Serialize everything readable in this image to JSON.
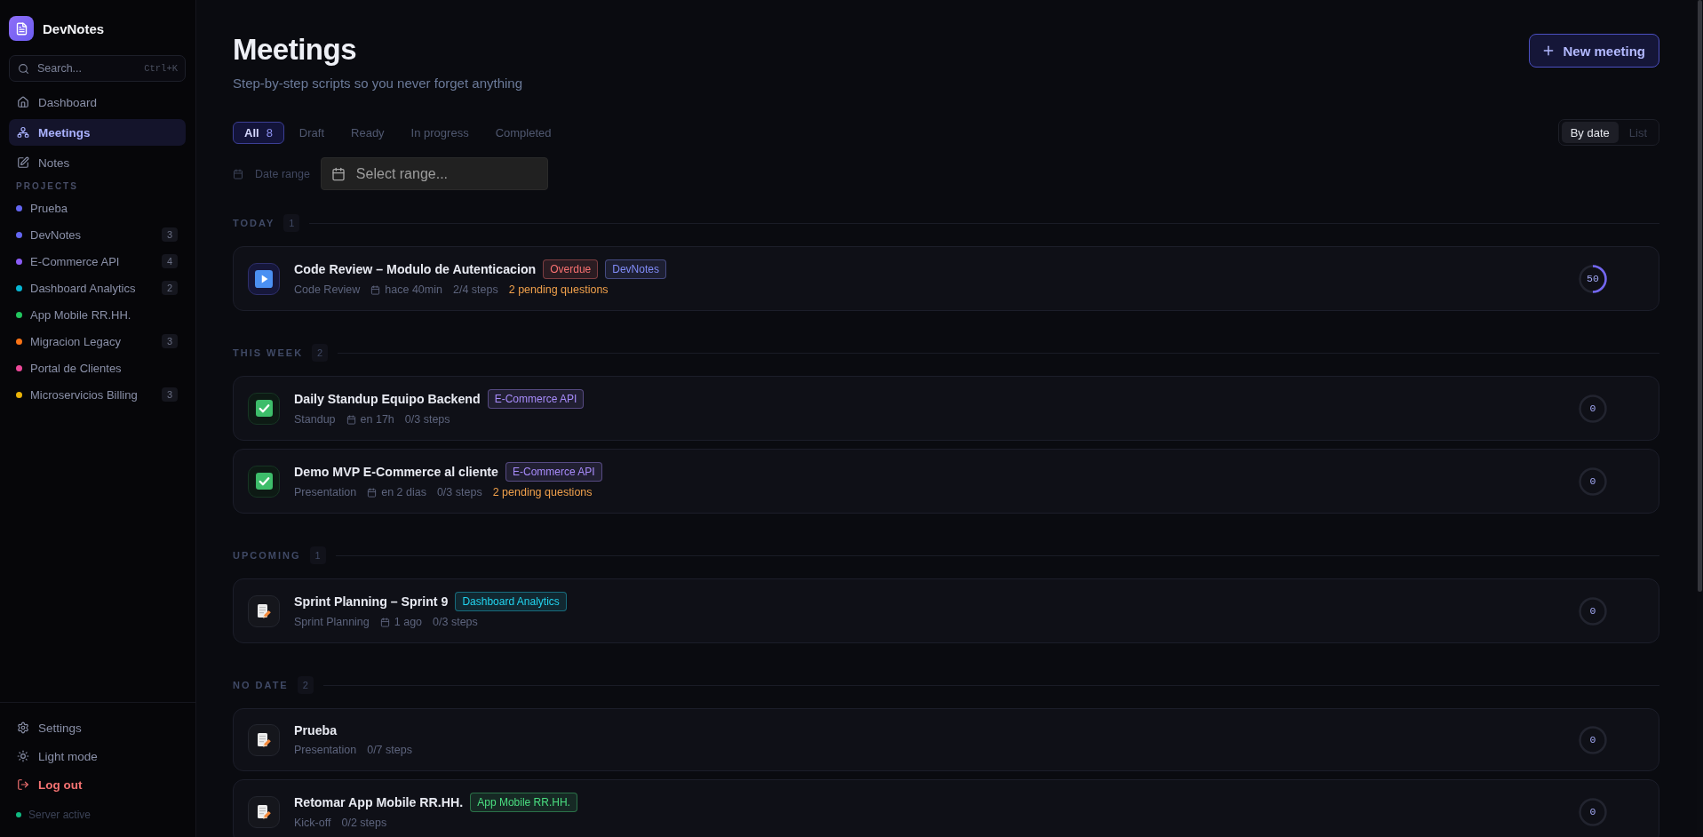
{
  "sidebar": {
    "brand": "DevNotes",
    "search": {
      "placeholder": "Search...",
      "shortcut": "Ctrl+K"
    },
    "nav": [
      {
        "label": "Dashboard",
        "selected": false
      },
      {
        "label": "Meetings",
        "selected": true
      },
      {
        "label": "Notes",
        "selected": false
      }
    ],
    "projects_heading": "PROJECTS",
    "projects": [
      {
        "name": "Prueba",
        "color": "#6366f1"
      },
      {
        "name": "DevNotes",
        "color": "#6366f1",
        "count": "3"
      },
      {
        "name": "E-Commerce API",
        "color": "#8b5cf6",
        "count": "4"
      },
      {
        "name": "Dashboard Analytics",
        "color": "#06b6d4",
        "count": "2"
      },
      {
        "name": "App Mobile RR.HH.",
        "color": "#22c55e"
      },
      {
        "name": "Migracion Legacy",
        "color": "#f97316",
        "count": "3"
      },
      {
        "name": "Portal de Clientes",
        "color": "#ec4899"
      },
      {
        "name": "Microservicios Billing",
        "color": "#eab308",
        "count": "3"
      }
    ],
    "footer": [
      {
        "label": "Settings",
        "kind": "link"
      },
      {
        "label": "Light mode",
        "kind": "link"
      },
      {
        "label": "Log out",
        "kind": "danger"
      }
    ],
    "server": {
      "label": "Server active",
      "online": true
    }
  },
  "header": {
    "title": "Meetings",
    "subtitle": "Step-by-step scripts so you never forget anything",
    "new_button": "New meeting"
  },
  "filters": [
    {
      "label": "All",
      "count": "8",
      "selected": true
    },
    {
      "label": "Draft",
      "selected": false
    },
    {
      "label": "Ready",
      "selected": false
    },
    {
      "label": "In progress",
      "selected": false
    },
    {
      "label": "Completed",
      "selected": false
    }
  ],
  "views": [
    {
      "label": "By date",
      "selected": true
    },
    {
      "label": "List",
      "selected": false
    }
  ],
  "date_range": {
    "label": "Date range",
    "placeholder": "Select range..."
  },
  "sections": [
    {
      "label": "TODAY",
      "count": "1",
      "meetings": [
        {
          "title": "Code Review – Modulo de Autenticacion",
          "kind": "started",
          "tags": [
            {
              "label": "Overdue",
              "color": "#f87171"
            },
            {
              "label": "DevNotes",
              "color": "#818cf8"
            }
          ],
          "type": "Code Review",
          "when": "hace 40min",
          "steps": "2/4 steps",
          "pending": "2 pending questions",
          "progress": {
            "level": 0.5,
            "label": "50"
          }
        }
      ]
    },
    {
      "label": "THIS WEEK",
      "count": "2",
      "meetings": [
        {
          "title": "Daily Standup Equipo Backend",
          "kind": "ready",
          "tags": [
            {
              "label": "E-Commerce API",
              "color": "#a78bfa"
            }
          ],
          "type": "Standup",
          "when": "en 17h",
          "steps": "0/3 steps",
          "progress": {
            "level": 0,
            "label": "0"
          }
        },
        {
          "title": "Demo MVP E-Commerce al cliente",
          "kind": "ready",
          "tags": [
            {
              "label": "E-Commerce API",
              "color": "#a78bfa"
            }
          ],
          "type": "Presentation",
          "when": "en 2 dias",
          "steps": "0/3 steps",
          "pending": "2 pending questions",
          "progress": {
            "level": 0,
            "label": "0"
          }
        }
      ]
    },
    {
      "label": "UPCOMING",
      "count": "1",
      "meetings": [
        {
          "title": "Sprint Planning – Sprint 9",
          "kind": "draft",
          "tags": [
            {
              "label": "Dashboard Analytics",
              "color": "#22d3ee"
            }
          ],
          "type": "Sprint Planning",
          "when": "1 ago",
          "steps": "0/3 steps",
          "progress": {
            "level": 0,
            "label": "0"
          }
        }
      ]
    },
    {
      "label": "NO DATE",
      "count": "2",
      "meetings": [
        {
          "title": "Prueba",
          "kind": "draft",
          "type": "Presentation",
          "steps": "0/7 steps",
          "progress": {
            "level": 0,
            "label": "0"
          }
        },
        {
          "title": "Retomar App Mobile RR.HH.",
          "kind": "draft",
          "tags": [
            {
              "label": "App Mobile RR.HH.",
              "color": "#4ade80"
            }
          ],
          "type": "Kick-off",
          "steps": "0/2 steps",
          "progress": {
            "level": 0,
            "label": "0"
          }
        }
      ]
    }
  ]
}
